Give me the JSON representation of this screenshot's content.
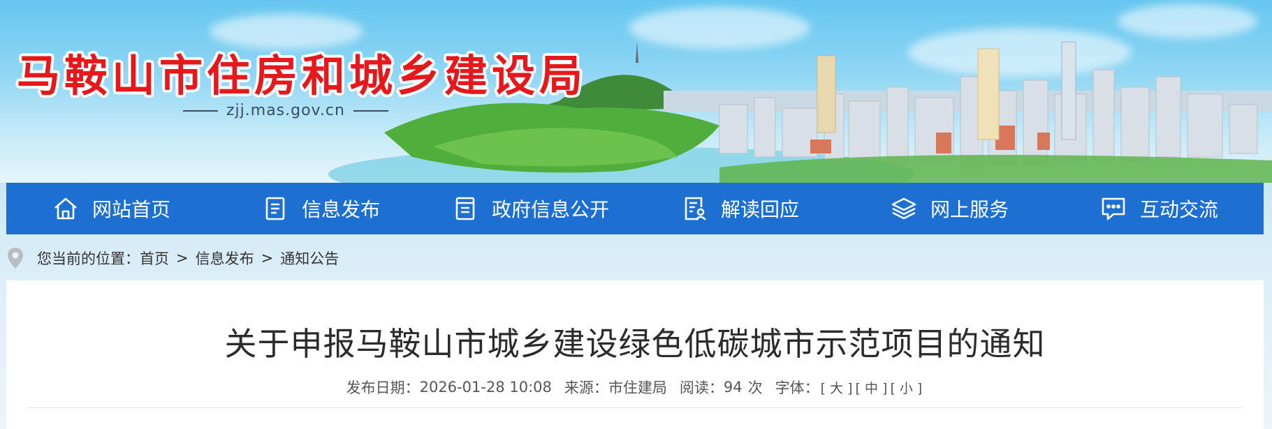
{
  "site": {
    "title": "马鞍山市住房和城乡建设局",
    "domain": "zjj.mas.gov.cn"
  },
  "nav": {
    "items": [
      {
        "label": "网站首页",
        "icon": "home-icon"
      },
      {
        "label": "信息发布",
        "icon": "document-list-icon"
      },
      {
        "label": "政府信息公开",
        "icon": "open-file-icon"
      },
      {
        "label": "解读回应",
        "icon": "interpret-icon"
      },
      {
        "label": "网上服务",
        "icon": "layers-icon"
      },
      {
        "label": "互动交流",
        "icon": "chat-icon"
      }
    ]
  },
  "breadcrumb": {
    "prefix": "您当前的位置：",
    "items": [
      "首页",
      "信息发布",
      "通知公告"
    ],
    "separator": ">"
  },
  "article": {
    "title": "关于申报马鞍山市城乡建设绿色低碳城市示范项目的通知",
    "date_label": "发布日期：",
    "date": "2026-01-28 10:08",
    "source_label": "来源：",
    "source": "市住建局",
    "views_label": "阅读：",
    "views": "94",
    "views_unit": "次",
    "font_label": "字体：",
    "font_large": "[ 大 ]",
    "font_medium": "[ 中 ]",
    "font_small": "[ 小 ]"
  },
  "colors": {
    "nav_bg": "#1d6fd2",
    "title_red": "#e6181b",
    "sky": "#66c6f0"
  }
}
